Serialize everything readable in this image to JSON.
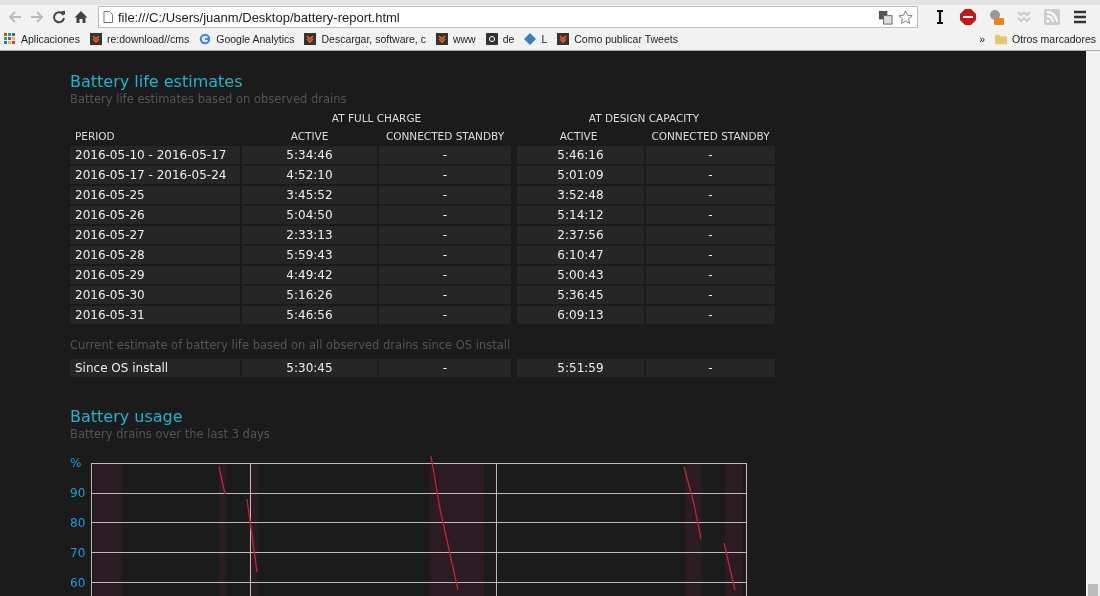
{
  "browser": {
    "url": "file:///C:/Users/juanm/Desktop/battery-report.html"
  },
  "bookmarks": [
    {
      "label": "Aplicaciones",
      "kind": "apps"
    },
    {
      "label": "re:download//cms",
      "kind": "site"
    },
    {
      "label": "Google Analytics",
      "kind": "google"
    },
    {
      "label": "Descargar, software, c",
      "kind": "site"
    },
    {
      "label": "www",
      "kind": "site"
    },
    {
      "label": "de",
      "kind": "amazon"
    },
    {
      "label": "L",
      "kind": "globe"
    },
    {
      "label": "Como publicar Tweets",
      "kind": "site"
    }
  ],
  "overflow": "»",
  "other_bookmarks": "Otros marcadores",
  "estimates": {
    "title": "Battery life estimates",
    "subtitle": "Battery life estimates based on observed drains",
    "groups": [
      "AT FULL CHARGE",
      "AT DESIGN CAPACITY"
    ],
    "columns": [
      "PERIOD",
      "ACTIVE",
      "CONNECTED STANDBY",
      "ACTIVE",
      "CONNECTED STANDBY"
    ],
    "rows": [
      [
        "2016-05-10 - 2016-05-17",
        "5:34:46",
        "-",
        "5:46:16",
        "-"
      ],
      [
        "2016-05-17 - 2016-05-24",
        "4:52:10",
        "-",
        "5:01:09",
        "-"
      ],
      [
        "2016-05-25",
        "3:45:52",
        "-",
        "3:52:48",
        "-"
      ],
      [
        "2016-05-26",
        "5:04:50",
        "-",
        "5:14:12",
        "-"
      ],
      [
        "2016-05-27",
        "2:33:13",
        "-",
        "2:37:56",
        "-"
      ],
      [
        "2016-05-28",
        "5:59:43",
        "-",
        "6:10:47",
        "-"
      ],
      [
        "2016-05-29",
        "4:49:42",
        "-",
        "5:00:43",
        "-"
      ],
      [
        "2016-05-30",
        "5:16:26",
        "-",
        "5:36:45",
        "-"
      ],
      [
        "2016-05-31",
        "5:46:56",
        "-",
        "6:09:13",
        "-"
      ]
    ],
    "os_note": "Current estimate of battery life based on all observed drains since OS install",
    "os_row": [
      "Since OS install",
      "5:30:45",
      "-",
      "5:51:59",
      "-"
    ]
  },
  "usage": {
    "title": "Battery usage",
    "subtitle": "Battery drains over the last 3 days",
    "unit": "%",
    "y_labels": [
      "90",
      "80",
      "70",
      "60"
    ]
  }
}
